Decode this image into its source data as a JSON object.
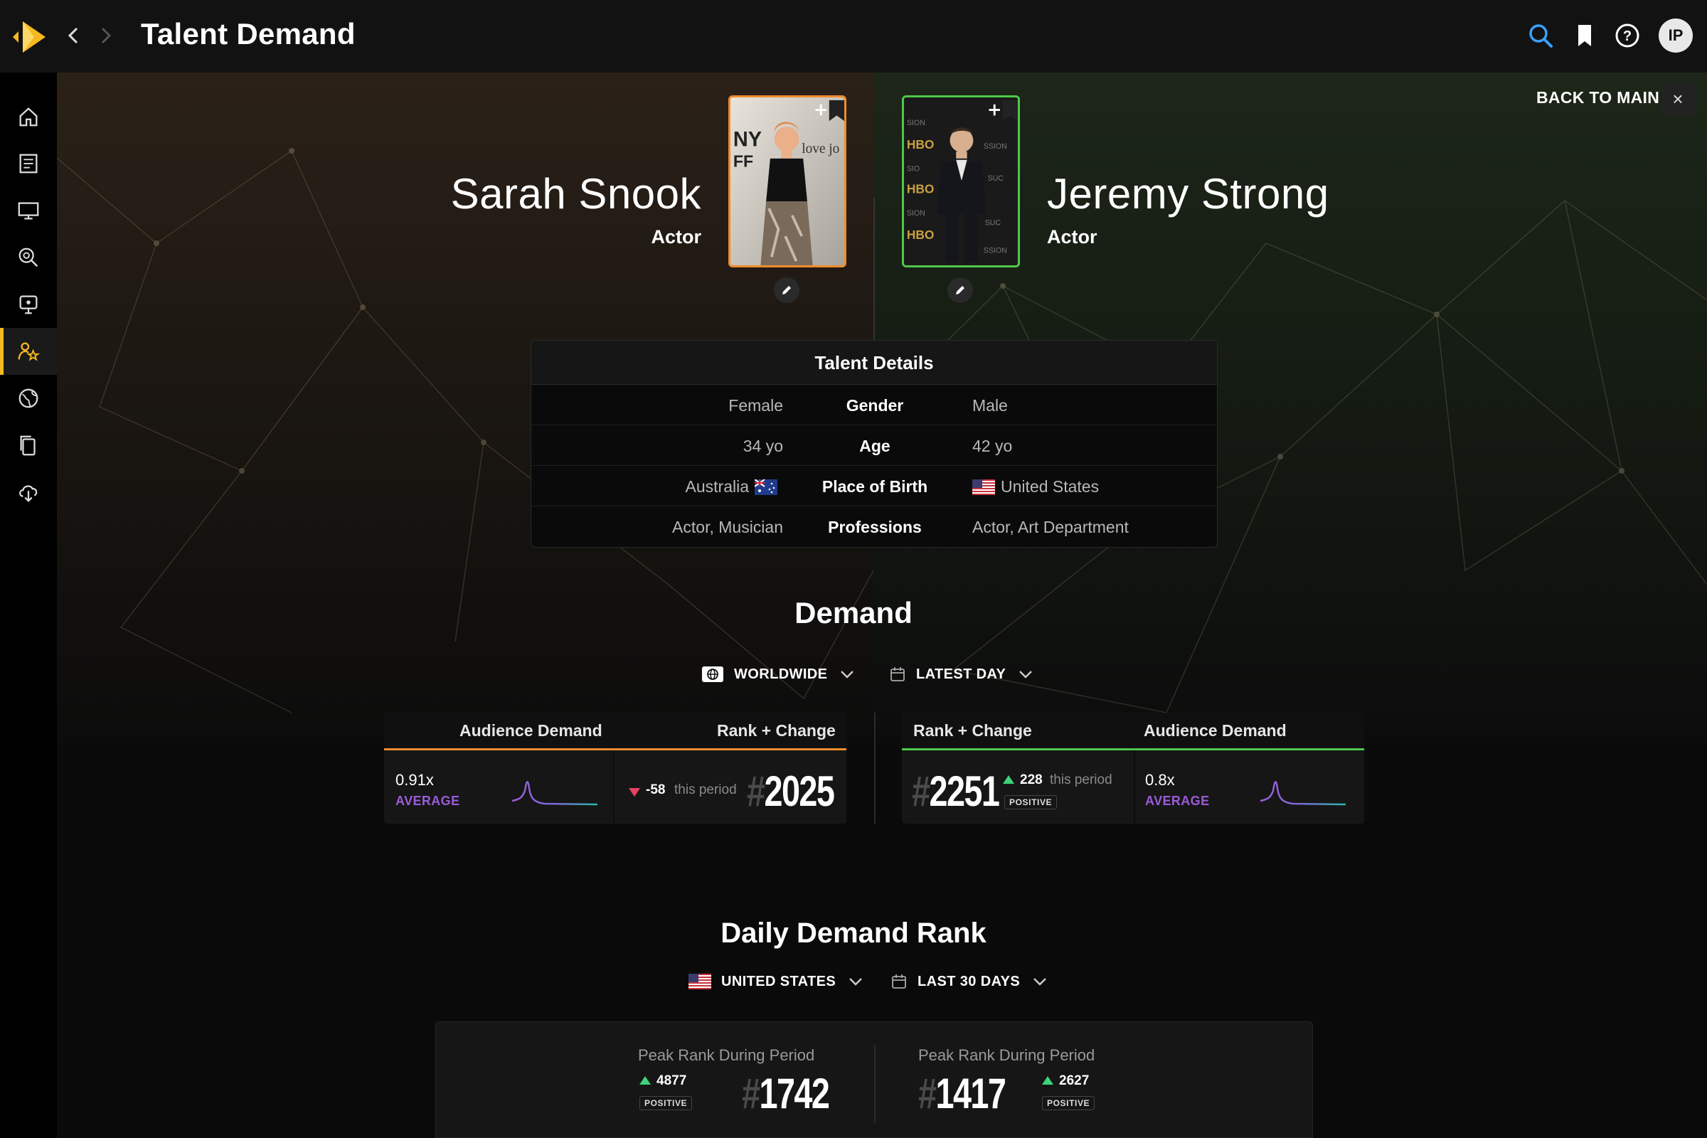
{
  "header": {
    "title": "Talent Demand",
    "user_initials": "IP",
    "icons": [
      "search-icon",
      "bookmark-icon",
      "help-icon"
    ]
  },
  "sidebar": {
    "items": [
      {
        "icon": "home-icon"
      },
      {
        "icon": "news-icon"
      },
      {
        "icon": "tv-icon"
      },
      {
        "icon": "search-analytics-icon"
      },
      {
        "icon": "broadcast-icon"
      },
      {
        "icon": "talent-star-icon",
        "active": true
      },
      {
        "icon": "globe-icon"
      },
      {
        "icon": "copy-icon"
      },
      {
        "icon": "cloud-download-icon"
      }
    ]
  },
  "comparison": {
    "back_label": "BACK TO MAIN",
    "left": {
      "name": "Sarah Snook",
      "role": "Actor",
      "accent": "#f08c2c"
    },
    "right": {
      "name": "Jeremy Strong",
      "role": "Actor",
      "accent": "#4cc84a"
    }
  },
  "talent_details": {
    "title": "Talent Details",
    "rows": [
      {
        "label": "Gender",
        "left": "Female",
        "right": "Male"
      },
      {
        "label": "Age",
        "left": "34 yo",
        "right": "42 yo"
      },
      {
        "label": "Place of Birth",
        "left": "Australia",
        "right": "United States"
      },
      {
        "label": "Professions",
        "left": "Actor, Musician",
        "right": "Actor, Art Department"
      }
    ]
  },
  "demand": {
    "title": "Demand",
    "region": "WORLDWIDE",
    "timeframe": "LATEST DAY",
    "audience_demand_label": "Audience Demand",
    "rank_change_label": "Rank + Change",
    "left": {
      "multiplier": "0.91x",
      "level": "AVERAGE",
      "change": "-58",
      "direction": "down",
      "period": "this period",
      "rank": "2025"
    },
    "right": {
      "multiplier": "0.8x",
      "level": "AVERAGE",
      "change": "228",
      "direction": "up",
      "period": "this period",
      "rank": "2251",
      "badge": "POSITIVE"
    }
  },
  "daily_rank": {
    "title": "Daily Demand Rank",
    "region": "UNITED STATES",
    "timeframe": "LAST 30 DAYS",
    "left": {
      "label": "Peak Rank During Period",
      "change": "4877",
      "badge": "POSITIVE",
      "rank": "1742"
    },
    "right": {
      "label": "Peak Rank During Period",
      "change": "2627",
      "badge": "POSITIVE",
      "rank": "1417"
    }
  },
  "colors": {
    "brand": "#f5b920",
    "left_accent": "#f08c2c",
    "right_accent": "#4cc84a",
    "average": "#9b5cd8",
    "negative": "#e9415f",
    "positive": "#3ed37a"
  }
}
